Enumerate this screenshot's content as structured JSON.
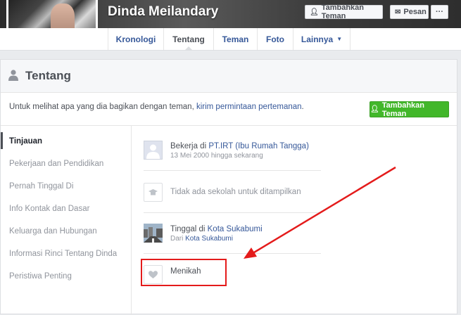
{
  "profile": {
    "name": "Dinda Meilandary",
    "add_friend_label": "Tambahkan Teman",
    "message_label": "Pesan",
    "more_label": "···"
  },
  "nav": {
    "tabs": [
      "Kronologi",
      "Tentang",
      "Teman",
      "Foto",
      "Lainnya"
    ],
    "active": "Tentang"
  },
  "section": {
    "title": "Tentang",
    "notice_prefix": "Untuk melihat apa yang dia bagikan dengan teman, ",
    "notice_link": "kirim permintaan pertemanan",
    "notice_suffix": ".",
    "add_friend_label": "Tambahkan Teman"
  },
  "sidebar": {
    "items": [
      "Tinjauan",
      "Pekerjaan dan Pendidikan",
      "Pernah Tinggal Di",
      "Info Kontak dan Dasar",
      "Keluarga dan Hubungan",
      "Informasi Rinci Tentang Dinda",
      "Peristiwa Penting"
    ],
    "active_index": 0
  },
  "overview": {
    "work": {
      "prefix": "Bekerja di ",
      "link": "PT.IRT (Ibu Rumah Tangga)",
      "sub": "13 Mei 2000 hingga sekarang"
    },
    "education": {
      "text": "Tidak ada sekolah untuk ditampilkan"
    },
    "lives": {
      "prefix": "Tinggal di ",
      "link": "Kota Sukabumi",
      "sub_prefix": "Dari ",
      "sub_link": "Kota Sukabumi"
    },
    "relationship": {
      "text": "Menikah"
    }
  },
  "colors": {
    "link": "#365899",
    "green_button": "#42b72a",
    "annotation_red": "#e41b1b"
  }
}
